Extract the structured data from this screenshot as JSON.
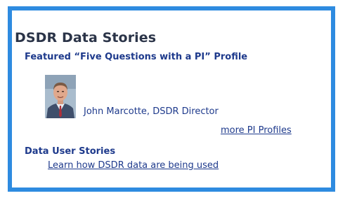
{
  "widget": {
    "title": "DSDR Data Stories",
    "featured_heading": "Featured “Five Questions with a PI” Profile",
    "profile": {
      "name": "John Marcotte, DSDR Director",
      "photo_icon": "person-photo"
    },
    "more_link": "more PI Profiles",
    "user_stories_heading": "Data User Stories",
    "learn_link": "Learn how DSDR data are being used"
  },
  "colors": {
    "border": "#2e8be0",
    "title": "#2b3448",
    "link": "#1e3a8c"
  }
}
